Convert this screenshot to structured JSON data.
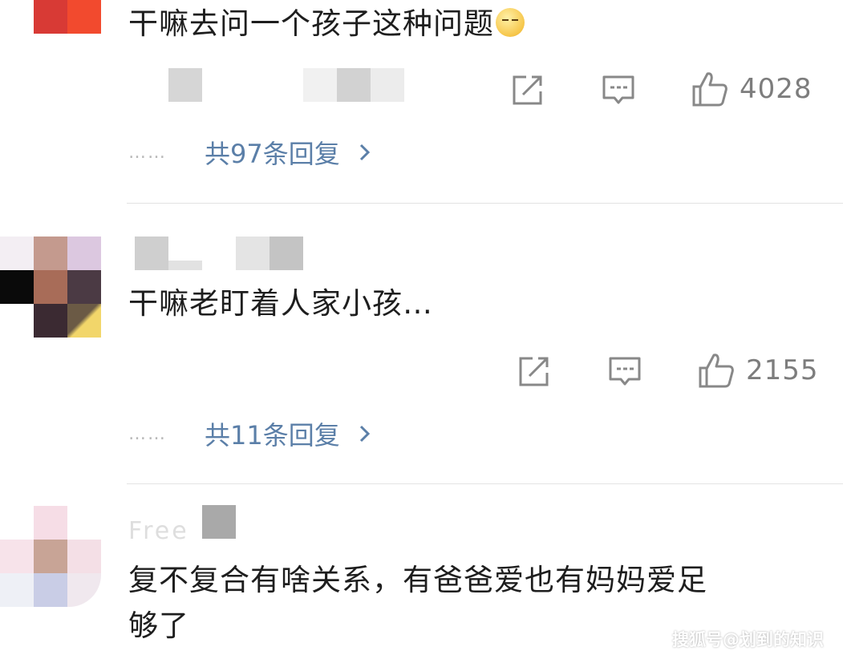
{
  "comments": [
    {
      "text": "干嘛去问一个孩子这种问题",
      "emoji_icon": "smirk-face-emoji",
      "like_count": "4028",
      "replies_label": "共97条回复",
      "dots": "……"
    },
    {
      "text": "干嘛老盯着人家小孩…",
      "like_count": "2155",
      "replies_label": "共11条回复",
      "dots": "……"
    },
    {
      "text_line1": "复不复合有啥关系，有爸爸爱也有妈妈爱足",
      "text_line2": "够了",
      "partial_name": "Free"
    }
  ],
  "icons": {
    "share": "share-icon",
    "comment": "comment-icon",
    "like": "thumbs-up-icon",
    "chevron": "chevron-right-icon"
  },
  "colors": {
    "link": "#5b7fa8",
    "icon": "#888888",
    "count": "#7d7d7d",
    "divider": "#e3e3e3"
  },
  "watermark": "搜狐号@划到的知识"
}
